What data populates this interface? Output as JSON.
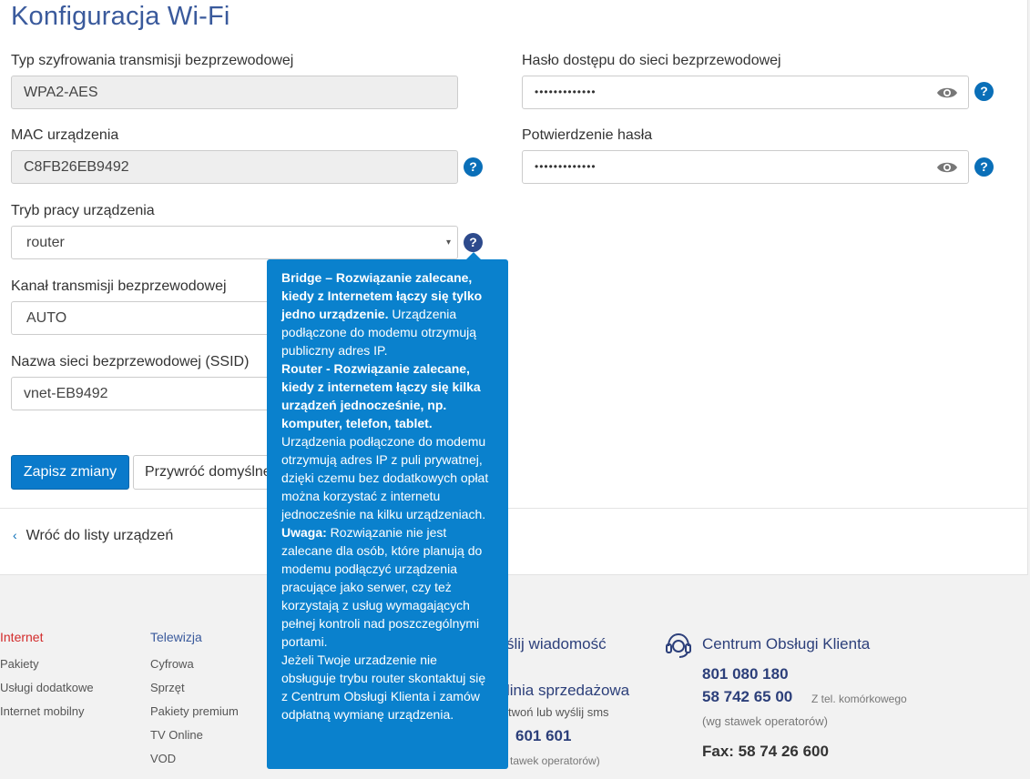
{
  "page": {
    "title": "Konfiguracja Wi-Fi"
  },
  "form": {
    "encryption_label": "Typ szyfrowania transmisji bezprzewodowej",
    "encryption_value": "WPA2-AES",
    "mac_label": "MAC urządzenia",
    "mac_value": "C8FB26EB9492",
    "mode_label": "Tryb pracy urządzenia",
    "mode_value": "router",
    "channel_label": "Kanał transmisji bezprzewodowej",
    "channel_value": "AUTO",
    "ssid_label": "Nazwa sieci bezprzewodowej (SSID)",
    "ssid_value": "vnet-EB9492",
    "password_label": "Hasło dostępu do sieci bezprzewodowej",
    "password_value": "•••••••••••••",
    "confirm_label": "Potwierdzenie hasła",
    "confirm_value": "•••••••••••••",
    "help_icon_text": "?",
    "caret": "▾"
  },
  "buttons": {
    "save": "Zapisz zmiany",
    "restore": "Przywróć domyślne"
  },
  "nav": {
    "back_chevron": "‹",
    "back_label": "Wróć do listy urządzeń"
  },
  "tooltip": {
    "p1_bold": "Bridge – Rozwiązanie zalecane, kiedy z Internetem łączy się tylko jedno urządzenie.",
    "p1_text": " Urządzenia podłączone do modemu otrzymują publiczny adres IP.",
    "p2_bold": "Router - Rozwiązanie zalecane, kiedy z internetem łączy się kilka urządzeń jednocześnie, np. komputer, telefon, tablet.",
    "p2_text": " Urządzenia podłączone do modemu otrzymują adres IP z puli prywatnej, dzięki czemu bez dodatkowych opłat można korzystać z internetu jednocześnie na kilku urządzeniach.",
    "p3_bold": "Uwaga:",
    "p3_text": " Rozwiązanie nie jest zalecane dla osób, które planują do modemu podłączyć urządzenia pracujące jako serwer, czy też korzystają z usług wymagających pełnej kontroli nad poszczególnymi portami.",
    "p4_text": "Jeżeli Twoje urzadzenie nie obsługuje trybu router skontaktuj się z Centrum Obsługi Klienta i zamów odpłatną wymianę urządzenia."
  },
  "footer": {
    "internet": {
      "heading": "Internet",
      "links": [
        "Pakiety",
        "Usługi dodatkowe",
        "Internet mobilny"
      ]
    },
    "tv": {
      "heading": "Telewizja",
      "links": [
        "Cyfrowa",
        "Sprzęt",
        "Pakiety premium",
        "TV Online",
        "VOD"
      ]
    },
    "message": {
      "heading_partial": "ślij wiadomość"
    },
    "sales": {
      "heading_partial": "linia sprzedażowa",
      "sub_partial": "twoń lub wyślij sms",
      "number_partial": "601 601",
      "rate_partial": "tawek operatorów)"
    },
    "support": {
      "heading": "Centrum Obsługi Klienta",
      "phone1": "801 080 180",
      "phone2": "58 742 65 00",
      "phone2_note": "Z tel. komórkowego",
      "rate": "(wg stawek operatorów)",
      "fax": "Fax: 58 74 26 600"
    }
  },
  "colors": {
    "accent": "#0a7acb",
    "title": "#3a5a9c",
    "tooltip_bg": "#0a81cd",
    "footer_red": "#d32b2b"
  }
}
